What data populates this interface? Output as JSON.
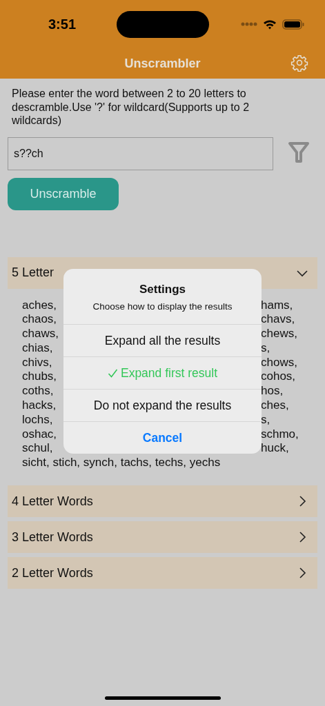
{
  "status_bar": {
    "time": "3:51"
  },
  "nav_bar": {
    "title": "Unscrambler"
  },
  "instructions": "Please enter the word between 2 to 20 letters to descramble.Use '?' for wildcard(Supports up to 2 wildcards)",
  "search": {
    "value": "s??ch"
  },
  "unscramble_button": "Unscramble",
  "sections": [
    {
      "title": "5 Letter",
      "expanded": true,
      "lines": [
        {
          "left": "aches,",
          "right": "hams,"
        },
        {
          "left": "chaos,",
          "right": "chavs,"
        },
        {
          "left": "chaws,",
          "right": "chews,"
        },
        {
          "left": "chias,",
          "right": "s,"
        },
        {
          "left": "chivs,",
          "right": "chows,"
        },
        {
          "left": "chubs,",
          "right": "cohos,"
        },
        {
          "left": "coths,",
          "right": "hos,"
        },
        {
          "left": "hacks,",
          "right": "ches,"
        },
        {
          "left": "lochs,",
          "right": "s,"
        },
        {
          "left": "oshac,",
          "right": "schmo,"
        },
        {
          "left": "schul,",
          "right": "huck,"
        },
        {
          "full": "sicht, stich, synch, tachs, techs, yechs"
        }
      ]
    },
    {
      "title": "4 Letter Words",
      "expanded": false
    },
    {
      "title": "3 Letter Words",
      "expanded": false
    },
    {
      "title": "2 Letter Words",
      "expanded": false
    }
  ],
  "dialog": {
    "title": "Settings",
    "message": "Choose how to display the results",
    "options": [
      {
        "label": "Expand all the results",
        "selected": false
      },
      {
        "label": "Expand first result",
        "selected": true
      },
      {
        "label": "Do not expand the results",
        "selected": false
      }
    ],
    "cancel": "Cancel"
  }
}
